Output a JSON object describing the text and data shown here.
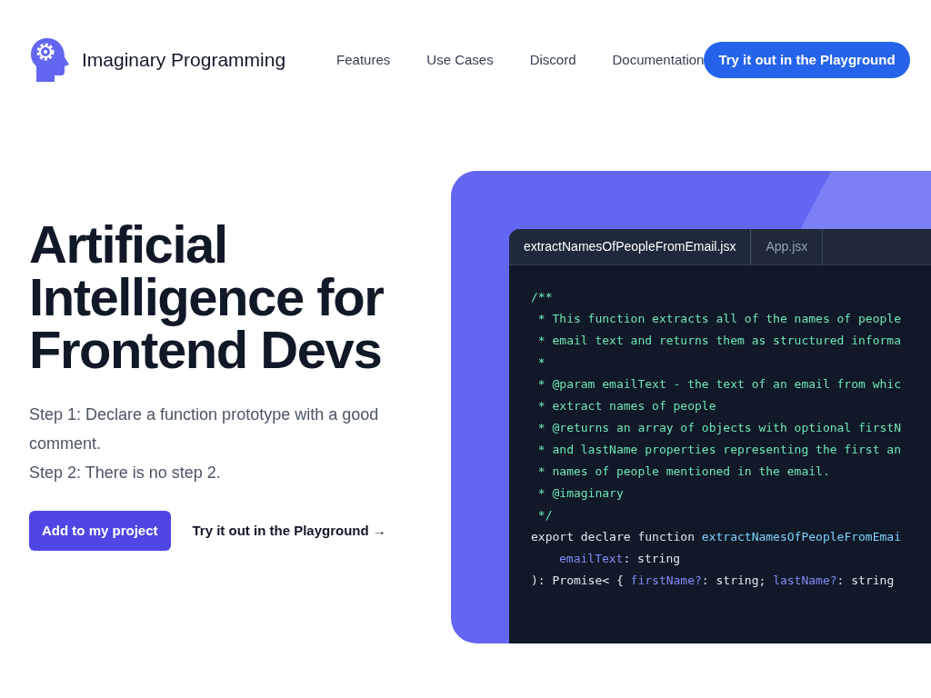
{
  "header": {
    "brand": "Imaginary Programming",
    "nav": [
      "Features",
      "Use Cases",
      "Discord",
      "Documentation"
    ],
    "cta": "Try it out in the Playground"
  },
  "hero": {
    "title": "Artificial Intelligence for Frontend Devs",
    "steps": [
      "Step 1: Declare a function prototype with a good comment.",
      "Step 2: There is no step 2."
    ],
    "primary": "Add to my project",
    "secondary": "Try it out in the Playground →"
  },
  "editor": {
    "tabs": [
      {
        "label": "extractNamesOfPeopleFromEmail.jsx",
        "selected": true
      },
      {
        "label": "App.jsx",
        "selected": false
      }
    ],
    "lines": [
      [
        {
          "text": "/**",
          "kind": "comment"
        }
      ],
      [
        {
          "text": " * This function extracts all of the names of people",
          "kind": "comment"
        }
      ],
      [
        {
          "text": " * email text and returns them as structured informa",
          "kind": "comment"
        }
      ],
      [
        {
          "text": " *",
          "kind": "comment"
        }
      ],
      [
        {
          "text": " * @param emailText - the text of an email from whic",
          "kind": "comment"
        }
      ],
      [
        {
          "text": " * extract names of people",
          "kind": "comment"
        }
      ],
      [
        {
          "text": " * @returns an array of objects with optional firstN",
          "kind": "comment"
        }
      ],
      [
        {
          "text": " * and lastName properties representing the first an",
          "kind": "comment"
        }
      ],
      [
        {
          "text": " * names of people mentioned in the email.",
          "kind": "comment"
        }
      ],
      [
        {
          "text": " * @imaginary",
          "kind": "comment"
        }
      ],
      [
        {
          "text": " */",
          "kind": "comment"
        }
      ],
      [
        {
          "text": "export declare function ",
          "kind": "plain"
        },
        {
          "text": "extractNamesOfPeopleFromEmai",
          "kind": "function"
        }
      ],
      [
        {
          "text": "emailText",
          "kind": "property",
          "indent": true
        },
        {
          "text": ": string",
          "kind": "plain"
        }
      ],
      [
        {
          "text": "): Promise< { ",
          "kind": "plain"
        },
        {
          "text": "firstName?",
          "kind": "property"
        },
        {
          "text": ": string; ",
          "kind": "plain"
        },
        {
          "text": "lastName?",
          "kind": "property"
        },
        {
          "text": ": string",
          "kind": "plain"
        }
      ]
    ]
  }
}
